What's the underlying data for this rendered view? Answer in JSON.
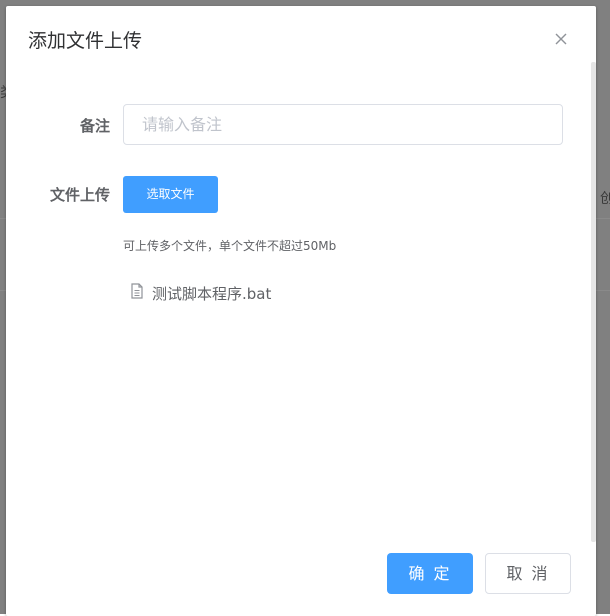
{
  "dialog": {
    "title": "添加文件上传",
    "close_icon": "close-icon"
  },
  "form": {
    "remark": {
      "label": "备注",
      "placeholder": "请输入备注",
      "value": ""
    },
    "upload": {
      "label": "文件上传",
      "button_label": "选取文件",
      "tip": "可上传多个文件，单个文件不超过50Mb",
      "files": [
        {
          "icon": "document-icon",
          "name": "测试脚本程序.bat"
        }
      ]
    }
  },
  "footer": {
    "confirm_label": "确 定",
    "cancel_label": "取 消"
  },
  "background": {
    "edge_left": "类",
    "edge_right": "创"
  },
  "colors": {
    "primary": "#409eff",
    "overlay": "#808080"
  }
}
